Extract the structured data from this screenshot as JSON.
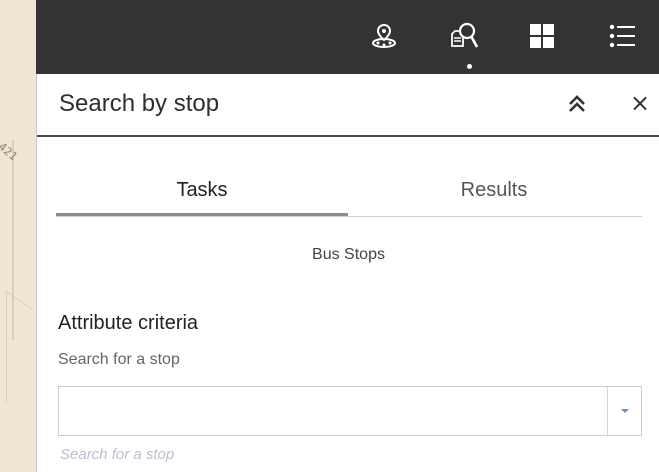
{
  "map": {
    "label": "421"
  },
  "toolbar": {
    "tools": [
      {
        "icon": "location-pin-icon"
      },
      {
        "icon": "search-document-icon"
      },
      {
        "icon": "grid-icon"
      },
      {
        "icon": "list-icon"
      }
    ],
    "active_tool": "search-document-icon"
  },
  "panel": {
    "title": "Search by stop",
    "collapse_icon": "double-chevron-up-icon",
    "close_label": "×",
    "tabs": [
      {
        "label": "Tasks",
        "selected": true
      },
      {
        "label": "Results",
        "selected": false
      }
    ],
    "layer": "Bus Stops",
    "attribute_criteria": "Attribute criteria",
    "search_label": "Search for a stop",
    "search_value": "",
    "search_hint": "Search for a stop"
  },
  "colors": {
    "toolbar_bg": "#333333",
    "map_bg": "#efe7d3",
    "hint_text": "#b9bfd0"
  }
}
